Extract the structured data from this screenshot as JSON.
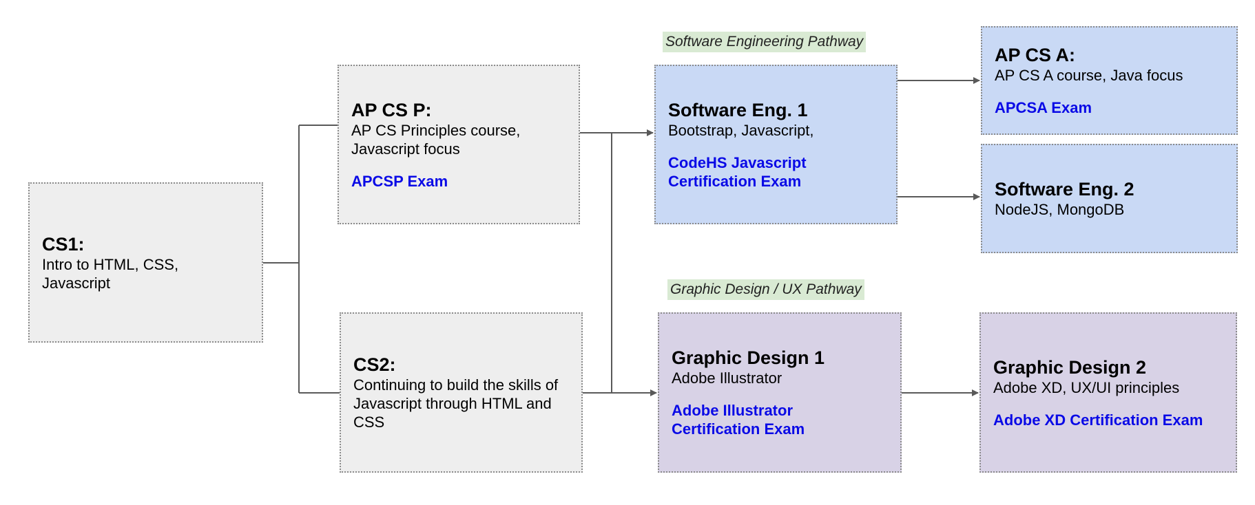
{
  "pathways": {
    "software": "Software Engineering Pathway",
    "graphic": "Graphic Design / UX Pathway"
  },
  "nodes": {
    "cs1": {
      "title": "CS1:",
      "desc": "Intro to HTML, CSS,\nJavascript",
      "exam": ""
    },
    "apcsp": {
      "title": "AP CS P:",
      "desc": "AP CS Principles course,\nJavascript focus",
      "exam": "APCSP Exam"
    },
    "cs2": {
      "title": "CS2:",
      "desc": "Continuing to build the skills of\nJavascript through HTML and\nCSS",
      "exam": ""
    },
    "se1": {
      "title": "Software Eng. 1",
      "desc": "Bootstrap, Javascript,",
      "exam": "CodeHS Javascript\nCertification Exam"
    },
    "gd1": {
      "title": "Graphic Design 1",
      "desc": "Adobe Illustrator",
      "exam": "Adobe Illustrator\nCertification Exam"
    },
    "apcsa": {
      "title": "AP CS A:",
      "desc": "AP CS A course, Java focus",
      "exam": "APCSA Exam"
    },
    "se2": {
      "title": "Software Eng. 2",
      "desc": "NodeJS, MongoDB",
      "exam": ""
    },
    "gd2": {
      "title": "Graphic Design 2",
      "desc": "Adobe XD, UX/UI principles",
      "exam": "Adobe XD Certification Exam"
    }
  },
  "colors": {
    "course_gray": "#eeeeee",
    "software_blue": "#c9d9f5",
    "design_purple": "#d8d2e6",
    "exam_blue": "#0a0ae6",
    "pathway_green": "#d9ead3",
    "connector": "#595959"
  }
}
